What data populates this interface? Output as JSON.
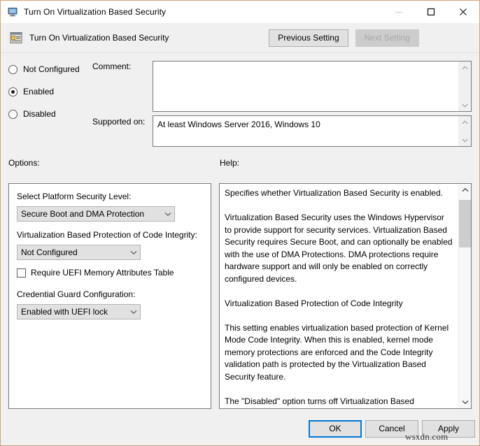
{
  "window": {
    "title": "Turn On Virtualization Based Security",
    "title_icon": "computer-monitor-icon",
    "minimize_label": "—",
    "maximize_label": "□",
    "close_label": "✕"
  },
  "header": {
    "icon": "policy-setting-icon",
    "title": "Turn On Virtualization Based Security",
    "previous_setting_label": "Previous Setting",
    "next_setting_label": "Next Setting",
    "next_setting_enabled": false
  },
  "state": {
    "options": [
      "Not Configured",
      "Enabled",
      "Disabled"
    ],
    "selected": "Enabled"
  },
  "fields": {
    "comment_label": "Comment:",
    "comment_value": "",
    "supported_label": "Supported on:",
    "supported_value": "At least Windows Server 2016, Windows 10"
  },
  "panels": {
    "options_label": "Options:",
    "help_label": "Help:"
  },
  "options_panel": {
    "platform_security_label": "Select Platform Security Level:",
    "platform_security_value": "Secure Boot and DMA Protection",
    "code_integrity_label": "Virtualization Based Protection of Code Integrity:",
    "code_integrity_value": "Not Configured",
    "uefi_memory_label": "Require UEFI Memory Attributes Table",
    "uefi_memory_checked": false,
    "credential_guard_label": "Credential Guard Configuration:",
    "credential_guard_value": "Enabled with UEFI lock"
  },
  "help": {
    "text": "Specifies whether Virtualization Based Security is enabled.\n\nVirtualization Based Security uses the Windows Hypervisor to provide support for security services. Virtualization Based Security requires Secure Boot, and can optionally be enabled with the use of DMA Protections. DMA protections require hardware support and will only be enabled on correctly configured devices.\n\nVirtualization Based Protection of Code Integrity\n\nThis setting enables virtualization based protection of Kernel Mode Code Integrity. When this is enabled, kernel mode memory protections are enforced and the Code Integrity validation path is protected by the Virtualization Based Security feature.\n\nThe \"Disabled\" option turns off Virtualization Based Protection of Code Integrity remotely if it was previously turned on with the \"Enabled without lock\" option."
  },
  "footer": {
    "ok_label": "OK",
    "cancel_label": "Cancel",
    "apply_label": "Apply"
  },
  "watermark": "wsxdn.com",
  "colors": {
    "window_border": "#d4a373",
    "focus_blue": "#0078d7",
    "dialog_bg": "#f0f0f0"
  }
}
